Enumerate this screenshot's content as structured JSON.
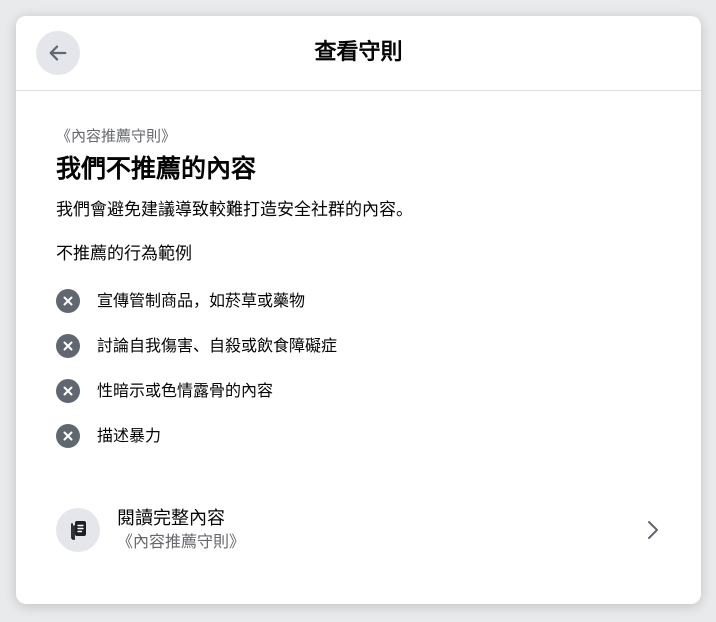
{
  "header": {
    "back_icon": "arrow-left-icon",
    "title": "查看守則"
  },
  "main": {
    "subtitle": "《內容推薦守則》",
    "title": "我們不推薦的內容",
    "description": "我們會避免建議導致較難打造安全社群的內容。",
    "section_label": "不推薦的行為範例",
    "examples": [
      {
        "icon": "x-circle-icon",
        "text": "宣傳管制商品，如菸草或藥物"
      },
      {
        "icon": "x-circle-icon",
        "text": "討論自我傷害、自殺或飲食障礙症"
      },
      {
        "icon": "x-circle-icon",
        "text": "性暗示或色情露骨的內容"
      },
      {
        "icon": "x-circle-icon",
        "text": "描述暴力"
      }
    ]
  },
  "read_more": {
    "icon": "book-icon",
    "title": "閱讀完整內容",
    "subtitle": "《內容推薦守則》",
    "chevron_icon": "chevron-right-icon"
  },
  "colors": {
    "background": "#e9eaec",
    "card": "#ffffff",
    "icon_circle": "#e4e6eb",
    "x_icon": "#606770",
    "secondary_text": "#65676b"
  }
}
